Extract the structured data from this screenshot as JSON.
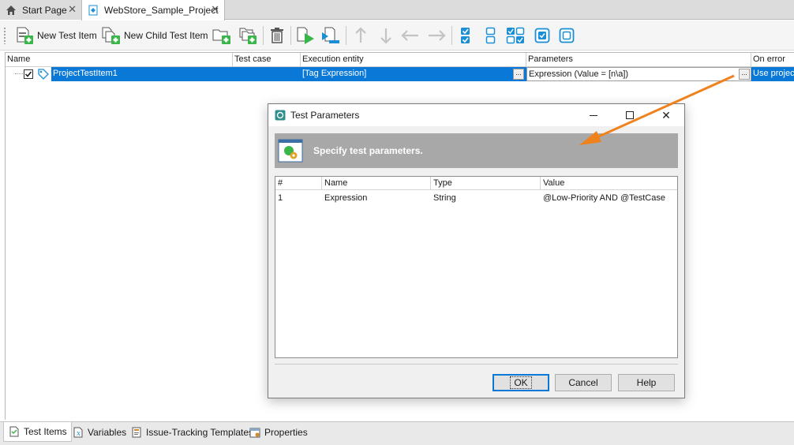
{
  "doc_tabs": [
    {
      "label": "Start Page",
      "icon": "home-icon"
    },
    {
      "label": "WebStore_Sample_Project",
      "icon": "project-icon",
      "active": true
    }
  ],
  "toolbar": {
    "new_test_item": "New Test Item",
    "new_child_test_item": "New Child Test Item"
  },
  "grid": {
    "headers": [
      "Name",
      "Test case",
      "Execution entity",
      "Parameters",
      "On error"
    ],
    "row": {
      "name": "ProjectTestItem1",
      "test_case": "",
      "execution_entity": "[Tag Expression]",
      "parameters": "Expression (Value = [n\\a])",
      "on_error": "Use project",
      "checked": true,
      "ellipsis": "..."
    }
  },
  "dialog": {
    "title": "Test Parameters",
    "banner": "Specify test parameters.",
    "headers": [
      "#",
      "Name",
      "Type",
      "Value"
    ],
    "rows": [
      {
        "num": "1",
        "name": "Expression",
        "type": "String",
        "value": "@Low-Priority AND @TestCase"
      }
    ],
    "ok": "OK",
    "cancel": "Cancel",
    "help": "Help"
  },
  "bottom_tabs": [
    {
      "label": "Test Items",
      "active": true
    },
    {
      "label": "Variables"
    },
    {
      "label": "Issue-Tracking Templates"
    },
    {
      "label": "Properties"
    }
  ],
  "colors": {
    "selection": "#0a78d7",
    "accent_green": "#39b54a",
    "accent_blue": "#1a8fd6",
    "arrow": "#f0821e"
  }
}
